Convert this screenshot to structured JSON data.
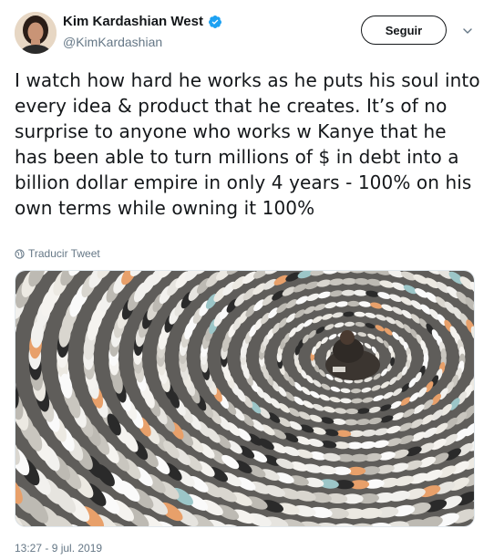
{
  "user": {
    "display_name": "Kim Kardashian West",
    "handle": "@KimKardashian",
    "verified": true
  },
  "actions": {
    "follow_label": "Seguir"
  },
  "tweet": {
    "text": "I watch how hard he works as he puts his soul into every idea & product that he creates. It’s of no surprise to anyone who works w Kanye that he has been able to turn millions of $ in debt into a billion dollar empire in only 4 years - 100% on his own terms while owning it 100%",
    "translate_label": "Traducir Tweet",
    "timestamp": "13:27 - 9 jul. 2019"
  },
  "icons": {
    "verified": "verified-badge-icon",
    "caret": "chevron-down-icon",
    "translate": "globe-icon"
  },
  "colors": {
    "verified_blue": "#1da1f2",
    "secondary_text": "#657786",
    "primary_text": "#14171a"
  }
}
